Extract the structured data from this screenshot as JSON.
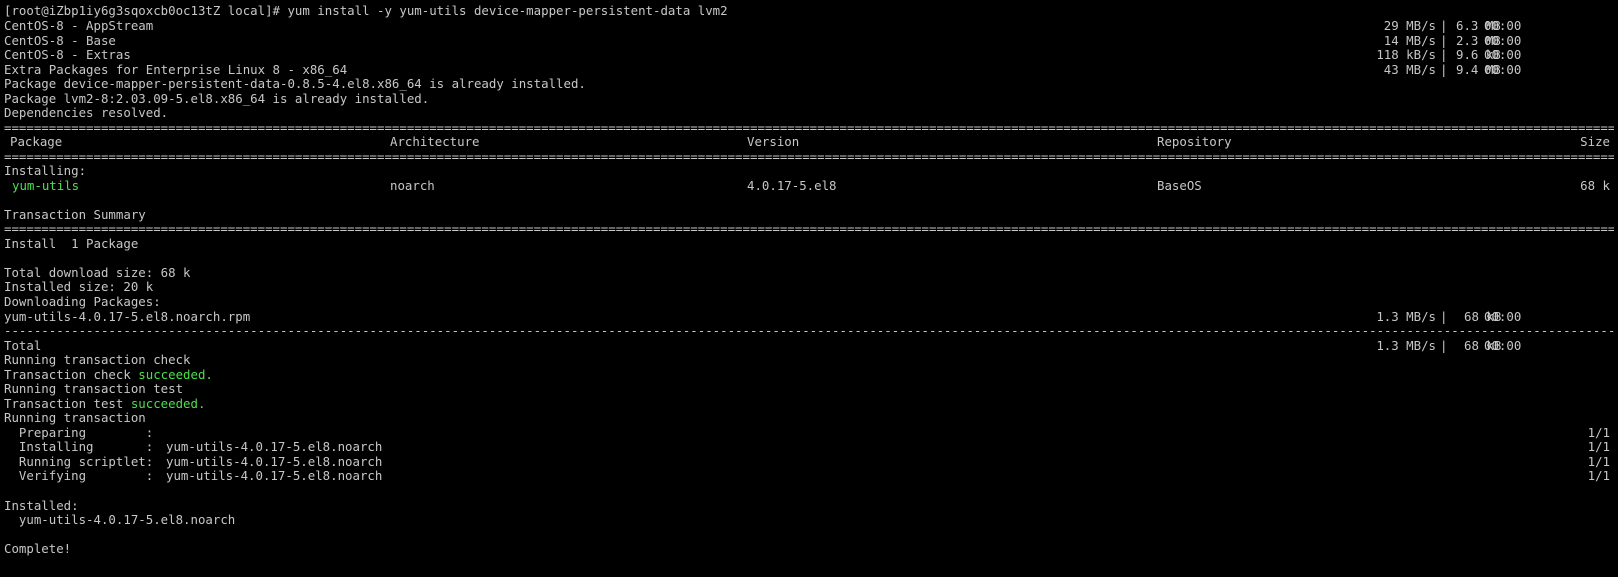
{
  "command_line": "[root@iZbp1iy6g3sqoxcb0oc13tZ local]# yum install -y yum-utils device-mapper-persistent-data lvm2",
  "repos": [
    {
      "name": "CentOS-8 - AppStream",
      "speed": "29 MB/s",
      "size": "6.3 MB",
      "time": "00:00"
    },
    {
      "name": "CentOS-8 - Base",
      "speed": "14 MB/s",
      "size": "2.3 MB",
      "time": "00:00"
    },
    {
      "name": "CentOS-8 - Extras",
      "speed": "118 kB/s",
      "size": "9.6 kB",
      "time": "00:00"
    },
    {
      "name": "Extra Packages for Enterprise Linux 8 - x86_64",
      "speed": "43 MB/s",
      "size": "9.4 MB",
      "time": "00:00"
    }
  ],
  "already_installed": [
    "Package device-mapper-persistent-data-0.8.5-4.el8.x86_64 is already installed.",
    "Package lvm2-8:2.03.09-5.el8.x86_64 is already installed."
  ],
  "deps_resolved": "Dependencies resolved.",
  "table": {
    "headers": {
      "package": "Package",
      "arch": "Architecture",
      "version": "Version",
      "repo": "Repository",
      "size": "Size"
    },
    "section": "Installing:",
    "row": {
      "package": "yum-utils",
      "arch": "noarch",
      "version": "4.0.17-5.el8",
      "repo": "BaseOS",
      "size": "68 k"
    }
  },
  "summary": {
    "title": "Transaction Summary",
    "install": "Install  1 Package",
    "total_download": "Total download size: 68 k",
    "installed_size": "Installed size: 20 k",
    "downloading": "Downloading Packages:",
    "rpm": {
      "name": "yum-utils-4.0.17-5.el8.noarch.rpm",
      "speed": "1.3 MB/s",
      "size": "68 kB",
      "time": "00:00"
    },
    "total": {
      "label": "Total",
      "speed": "1.3 MB/s",
      "size": "68 kB",
      "time": "00:00"
    }
  },
  "transaction": {
    "check": "Running transaction check",
    "check_result_prefix": "Transaction check ",
    "check_result": "succeeded.",
    "test": "Running transaction test",
    "test_result_prefix": "Transaction test ",
    "test_result": "succeeded.",
    "running": "Running transaction",
    "steps": [
      {
        "label": "  Preparing        :",
        "pkg": "",
        "count": "1/1"
      },
      {
        "label": "  Installing       :",
        "pkg": "yum-utils-4.0.17-5.el8.noarch",
        "count": "1/1"
      },
      {
        "label": "  Running scriptlet:",
        "pkg": "yum-utils-4.0.17-5.el8.noarch",
        "count": "1/1"
      },
      {
        "label": "  Verifying        :",
        "pkg": "yum-utils-4.0.17-5.el8.noarch",
        "count": "1/1"
      }
    ]
  },
  "installed_header": "Installed:",
  "installed_pkg": "  yum-utils-4.0.17-5.el8.noarch",
  "complete": "Complete!",
  "colors": {
    "background": "#000000",
    "text": "#c7c7c7",
    "highlight": "#4be04b"
  }
}
